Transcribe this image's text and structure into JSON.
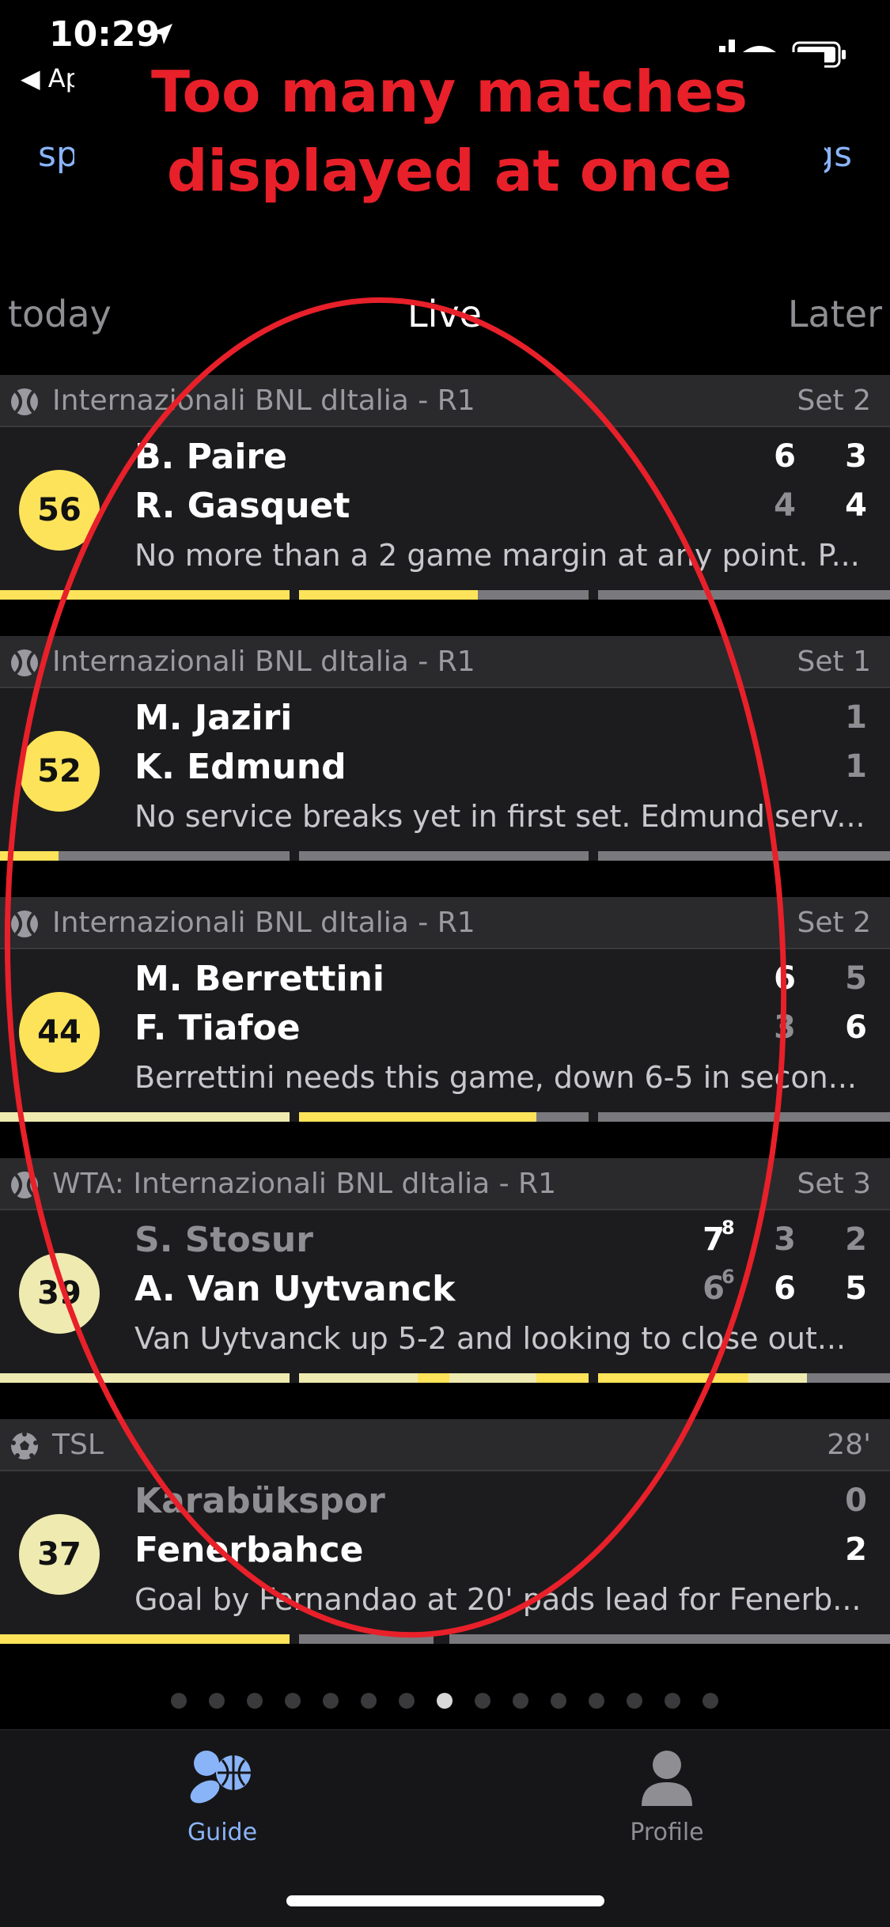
{
  "status_bar": {
    "time": "10:29",
    "back_label": "Ap"
  },
  "nav": {
    "left_label": "sp",
    "right_label": "gs"
  },
  "annotation": {
    "text": "Too many matches\ndisplayed at once",
    "color": "#e8202a"
  },
  "tabs": {
    "today": "today",
    "live": "Live",
    "later": "Later"
  },
  "matches": [
    {
      "league": "Internazionali BNL dItalia - R1",
      "sport_icon": "tennis-ball-icon",
      "status": "Set 2",
      "rating": "56",
      "p1": "B. Paire",
      "p2": "R. Gasquet",
      "s1": [
        "6",
        "3"
      ],
      "s2": [
        "4",
        "4"
      ],
      "desc": "No more than a 2 game margin at any point. P..."
    },
    {
      "league": "Internazionali BNL dItalia - R1",
      "sport_icon": "tennis-ball-icon",
      "status": "Set 1",
      "rating": "52",
      "p1": "M. Jaziri",
      "p2": "K. Edmund",
      "s1": [
        "1"
      ],
      "s2": [
        "1"
      ],
      "desc": "No service breaks yet in first set. Edmund serv..."
    },
    {
      "league": "Internazionali BNL dItalia - R1",
      "sport_icon": "tennis-ball-icon",
      "status": "Set 2",
      "rating": "44",
      "p1": "M. Berrettini",
      "p2": "F. Tiafoe",
      "s1": [
        "6",
        "5"
      ],
      "s2": [
        "3",
        "6"
      ],
      "desc": "Berrettini needs this game, down 6-5 in secon..."
    },
    {
      "league": "WTA: Internazionali BNL dItalia - R1",
      "sport_icon": "tennis-ball-icon",
      "status": "Set 3",
      "rating": "39",
      "p1": "S. Stosur",
      "p2": "A. Van Uytvanck",
      "s1": [
        "7",
        "3",
        "2"
      ],
      "s2": [
        "6",
        "6",
        "5"
      ],
      "tb1": "8",
      "tb2": "6",
      "desc": "Van Uytvanck up 5-2 and looking to close out..."
    },
    {
      "league": "TSL",
      "sport_icon": "soccer-ball-icon",
      "status": "28'",
      "rating": "37",
      "p1": "Karabükspor",
      "p2": "Fenerbahce",
      "s1": [
        "0"
      ],
      "s2": [
        "2"
      ],
      "desc": "Goal by Fernandao at 20' pads lead for Fenerb..."
    }
  ],
  "tab_bar": {
    "guide": "Guide",
    "profile": "Profile"
  },
  "colors": {
    "accent": "#8ab4f8",
    "hot": "#fde35a",
    "warm": "#efeab0",
    "annotation_red": "#e8202a"
  }
}
